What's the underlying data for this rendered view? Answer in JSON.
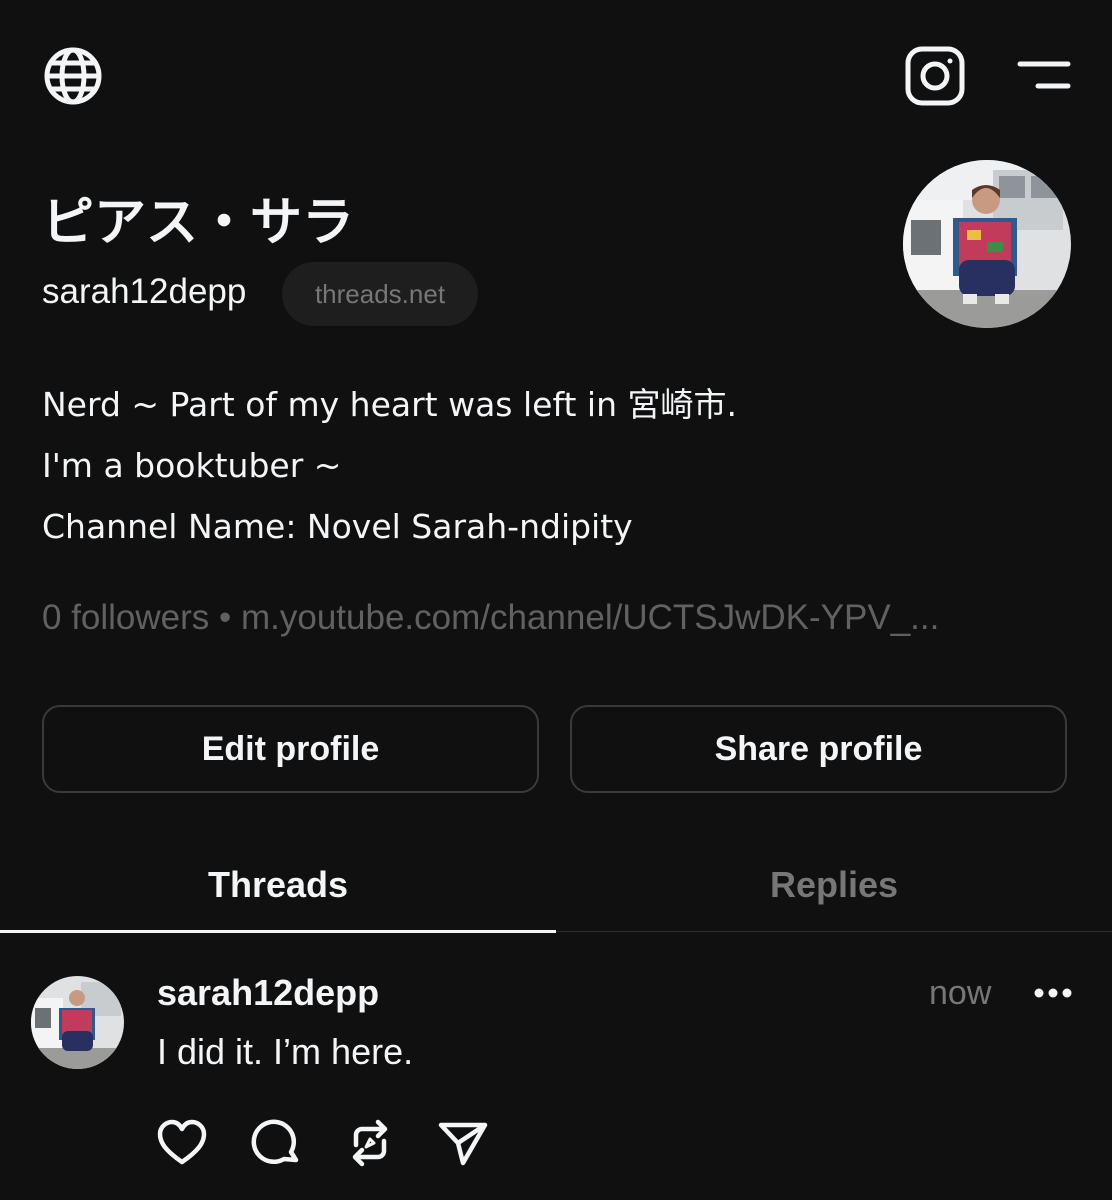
{
  "top_bar": {
    "icons": [
      "globe-icon",
      "instagram-icon",
      "menu-icon"
    ]
  },
  "profile": {
    "display_name": "ピアス・サラ",
    "username": "sarah12depp",
    "domain_badge": "threads.net",
    "bio_lines": [
      "Nerd ~ Part of my heart was left in 宮崎市.",
      "I'm a booktuber ~",
      "Channel Name: Novel Sarah-ndipity"
    ],
    "followers_text": "0 followers",
    "separator": " • ",
    "link_text": "m.youtube.com/channel/UCTSJwDK-YPV_..."
  },
  "actions": {
    "edit_label": "Edit profile",
    "share_label": "Share profile"
  },
  "tabs": [
    {
      "label": "Threads",
      "active": true
    },
    {
      "label": "Replies",
      "active": false
    }
  ],
  "post": {
    "author": "sarah12depp",
    "time": "now",
    "text": "I did it. I’m here.",
    "action_icons": [
      "heart-icon",
      "comment-icon",
      "repost-icon",
      "send-icon"
    ]
  },
  "colors": {
    "background": "#101010",
    "text_primary": "#f3f5f7",
    "text_secondary": "#777777",
    "border": "#3a3a3a"
  }
}
